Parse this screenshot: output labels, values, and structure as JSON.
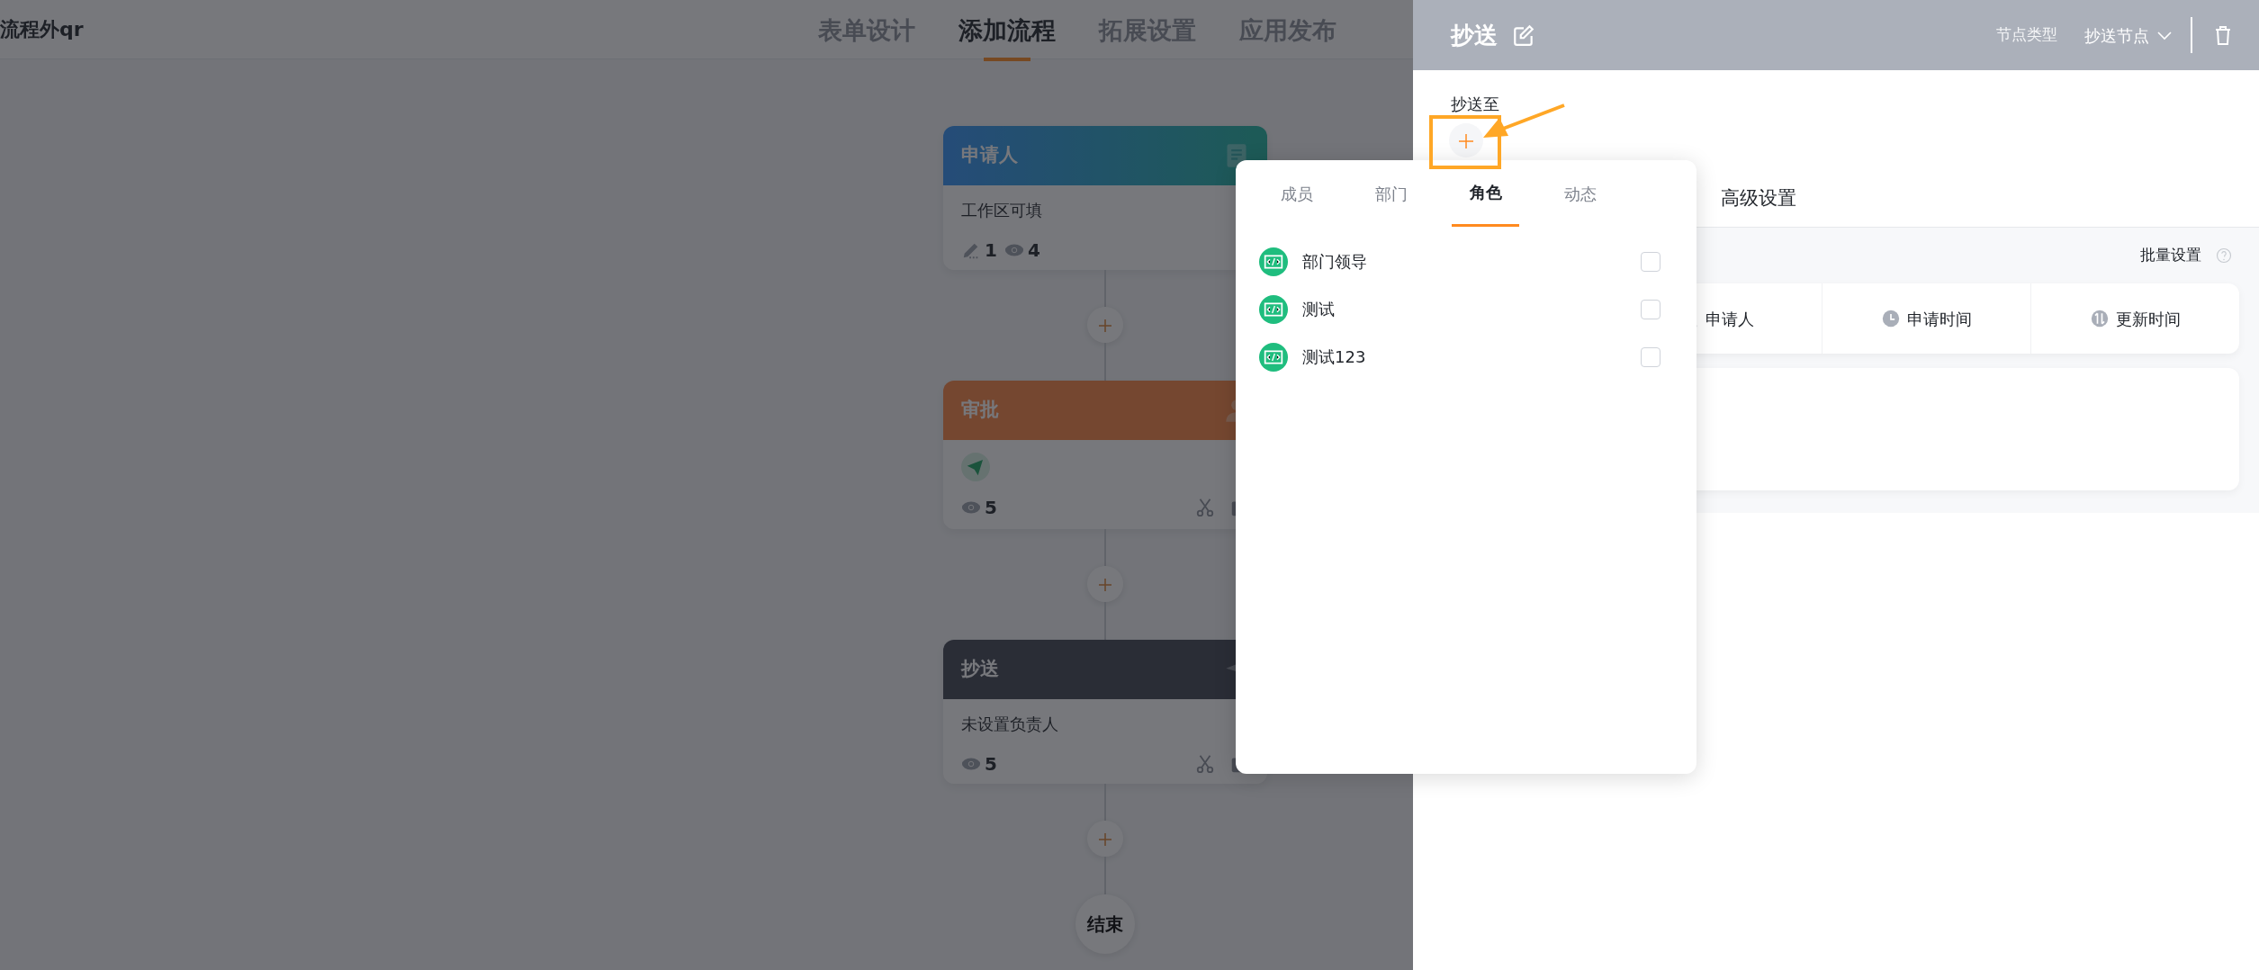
{
  "app_title": "流程外qr",
  "top_tabs": [
    {
      "label": "表单设计",
      "selected": false
    },
    {
      "label": "添加流程",
      "selected": true
    },
    {
      "label": "拓展设置",
      "selected": false
    },
    {
      "label": "应用发布",
      "selected": false
    }
  ],
  "flow": {
    "nodes": [
      {
        "kind": "applicant",
        "title": "申请人",
        "body": "工作区可填",
        "stats": [
          {
            "kind": "edit",
            "value": "1"
          },
          {
            "kind": "view",
            "value": "4"
          }
        ]
      },
      {
        "kind": "approval",
        "title": "审批",
        "stats": [
          {
            "kind": "view",
            "value": "5"
          }
        ]
      },
      {
        "kind": "cc",
        "title": "抄送",
        "body": "未设置负责人",
        "stats": [
          {
            "kind": "view",
            "value": "5"
          }
        ]
      }
    ],
    "end_label": "结束"
  },
  "drawer": {
    "title": "抄送",
    "type_label": "节点类型",
    "type_value": "抄送节点",
    "recipients_label": "抄送至",
    "settings_tab": "高级设置",
    "batch_label": "批量设置",
    "columns": [
      {
        "kind": "person",
        "label": "申请人"
      },
      {
        "kind": "clock",
        "label": "申请时间"
      },
      {
        "kind": "sort",
        "label": "更新时间"
      }
    ]
  },
  "picker": {
    "tabs": [
      {
        "label": "成员",
        "selected": false
      },
      {
        "label": "部门",
        "selected": false
      },
      {
        "label": "角色",
        "selected": true
      },
      {
        "label": "动态",
        "selected": false
      }
    ],
    "items": [
      {
        "label": "部门领导",
        "checked": false
      },
      {
        "label": "测试",
        "checked": false
      },
      {
        "label": "测试123",
        "checked": false
      }
    ]
  }
}
